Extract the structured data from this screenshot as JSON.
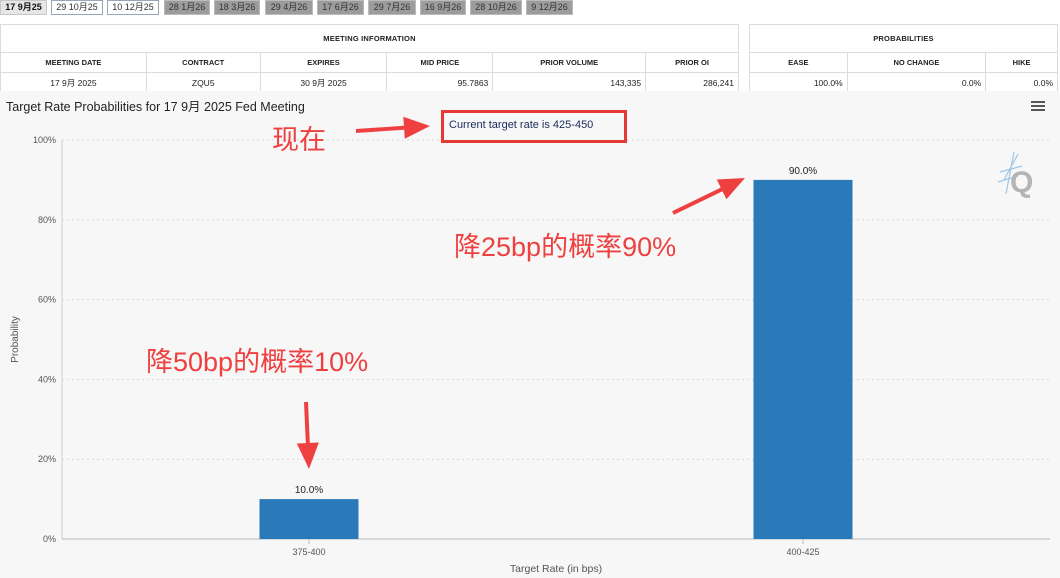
{
  "tabs": [
    {
      "label": "17 9月25",
      "state": "active"
    },
    {
      "label": "29 10月25",
      "state": "light"
    },
    {
      "label": "10 12月25",
      "state": "light"
    },
    {
      "label": "28 1月26",
      "state": "normal"
    },
    {
      "label": "18 3月26",
      "state": "normal"
    },
    {
      "label": "29 4月26",
      "state": "normal"
    },
    {
      "label": "17 6月26",
      "state": "normal"
    },
    {
      "label": "29 7月26",
      "state": "normal"
    },
    {
      "label": "16 9月26",
      "state": "normal"
    },
    {
      "label": "28 10月26",
      "state": "normal"
    },
    {
      "label": "9 12月26",
      "state": "normal"
    }
  ],
  "meeting_info": {
    "group_title": "MEETING INFORMATION",
    "headers": {
      "meeting_date": "MEETING DATE",
      "contract": "CONTRACT",
      "expires": "EXPIRES",
      "mid_price": "MID PRICE",
      "prior_volume": "PRIOR VOLUME",
      "prior_oi": "PRIOR OI"
    },
    "row": {
      "meeting_date": "17 9月 2025",
      "contract": "ZQU5",
      "expires": "30 9月 2025",
      "mid_price": "95.7863",
      "prior_volume": "143,335",
      "prior_oi": "286,241"
    }
  },
  "probabilities": {
    "group_title": "PROBABILITIES",
    "headers": {
      "ease": "EASE",
      "no_change": "NO CHANGE",
      "hike": "HIKE"
    },
    "row": {
      "ease": "100.0%",
      "no_change": "0.0%",
      "hike": "0.0%"
    }
  },
  "chart_title": "Target Rate Probabilities for 17 9月 2025 Fed Meeting",
  "current_target_note": "Current target rate is 425-450",
  "annotations": {
    "now": "现在",
    "cut25": "降25bp的概率90%",
    "cut50": "降50bp的概率10%",
    "color": "#ef4040"
  },
  "icons": {
    "menu": "hamburger-menu-icon",
    "watermark": "q-logo-icon"
  },
  "colors": {
    "bar": "#2a7ab9",
    "plot_bg": "#f7f7f7",
    "annotation": "#ef4040"
  },
  "chart_data": {
    "type": "bar",
    "categories": [
      "375-400",
      "400-425"
    ],
    "values": [
      10.0,
      90.0
    ],
    "data_labels": [
      "10.0%",
      "90.0%"
    ],
    "title": "Target Rate Probabilities for 17 9月 2025 Fed Meeting",
    "xlabel": "Target Rate (in bps)",
    "ylabel": "Probability",
    "ylim": [
      0,
      100
    ],
    "yticks": [
      0,
      20,
      40,
      60,
      80,
      100
    ],
    "ytick_labels": [
      "0%",
      "20%",
      "40%",
      "60%",
      "80%",
      "100%"
    ],
    "grid": true,
    "legend": "none"
  }
}
